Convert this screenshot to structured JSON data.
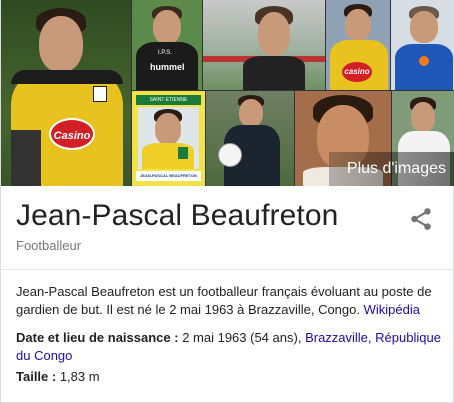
{
  "gallery": {
    "more_label": "Plus d'images",
    "tiles": [
      {
        "name": "photo-goalkeeper-casino-jersey",
        "logo": "Casino"
      },
      {
        "name": "photo-coach-hummel",
        "shirt_text": "hummel",
        "shirt_text2": "I.P.S."
      },
      {
        "name": "photo-stadium-portrait"
      },
      {
        "name": "photo-casino-jersey-2",
        "logo": "casino"
      },
      {
        "name": "photo-montpellier-coach"
      },
      {
        "name": "photo-panini-sticker",
        "sticker_top": "SAINT-ETIENNE",
        "sticker_bottom": "JEAN-PASCAL BEAUFRETON"
      },
      {
        "name": "photo-coach-with-ball"
      },
      {
        "name": "photo-closeup-portrait"
      },
      {
        "name": "photo-training-white-shirt"
      }
    ]
  },
  "header": {
    "title": "Jean-Pascal Beaufreton",
    "subtitle": "Footballeur"
  },
  "description": {
    "text": "Jean-Pascal Beaufreton est un footballeur français évoluant au poste de gardien de but. Il est né le 2 mai 1963 à Brazzaville, Congo.",
    "source_link": "Wikipédia"
  },
  "facts": {
    "birth": {
      "label": "Date et lieu de naissance :",
      "value": " 2 mai 1963 (54 ans),",
      "link1": "Brazzaville,",
      "link2": "République du Congo"
    },
    "height": {
      "label": "Taille :",
      "value": " 1,83 m"
    }
  },
  "colors": {
    "link": "#1a0dab",
    "title": "#222222",
    "subtitle": "#777777"
  }
}
